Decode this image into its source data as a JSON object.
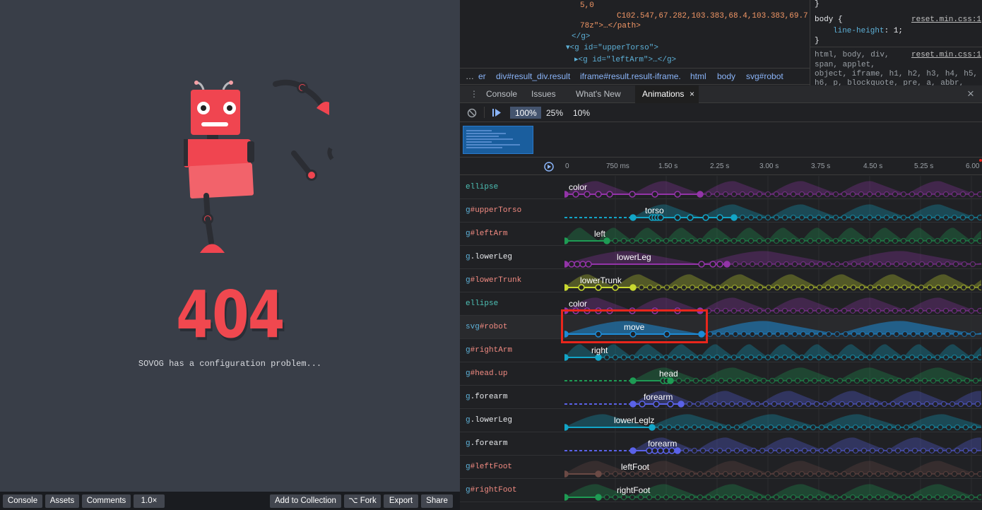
{
  "preview": {
    "big_number": "404",
    "message": "SOVOG has a configuration problem...",
    "bottom_bar": {
      "console": "Console",
      "assets": "Assets",
      "comments": "Comments",
      "zoom": "1.0×",
      "add_collection": "Add to Collection",
      "fork": "⌥ Fork",
      "export": "Export",
      "share": "Share"
    }
  },
  "elements_panel": {
    "lines": [
      "5,0",
      "C102.547,67.282,103.383,68.4,103.383,69.7",
      "78z\">…</path>",
      "</g>",
      "▾<g id=\"upperTorso\">",
      "▸<g id=\"leftArm\">…</g>"
    ],
    "breadcrumbs": [
      "…",
      "er",
      "div#result_div.result",
      "iframe#result.result-iframe.",
      "html",
      "body",
      "svg#robot"
    ]
  },
  "styles_panel": {
    "rule1_selector": "body {",
    "rule1_source": "reset.min.css:1",
    "rule1_prop": "line-height",
    "rule1_value": "1;",
    "rule2_source": "reset.min.css:1",
    "rule2_text_1": "html, body, div,",
    "rule2_text_2": "span, applet,",
    "rule2_text_3": "object, iframe, h1, h2, h3, h4, h5,",
    "rule2_text_4": "h6, p, blockquote, pre, a, abbr,",
    "brace": "}"
  },
  "drawer": {
    "tabs": [
      "Console",
      "Issues",
      "What's New",
      "Animations"
    ],
    "active_tab": "Animations",
    "speeds": [
      "100%",
      "25%",
      "10%"
    ],
    "active_speed": "100%"
  },
  "timeline": {
    "ticks": [
      "0",
      "750 ms",
      "1.50 s",
      "2.25 s",
      "3.00 s",
      "3.75 s",
      "4.50 s",
      "5.25 s",
      "6.00"
    ],
    "rows": [
      {
        "tag": "ellipse",
        "name": "color",
        "color": "#9334a8"
      },
      {
        "tag": "g",
        "id": "#upperTorso",
        "name": "torso",
        "color": "#12a5c7"
      },
      {
        "tag": "g",
        "id": "#leftArm",
        "name": "left",
        "color": "#1e9b54"
      },
      {
        "tag": "g",
        "cls": ".lowerLeg",
        "name": "lowerLeg",
        "color": "#9334a8"
      },
      {
        "tag": "g",
        "id": "#lowerTrunk",
        "name": "lowerTrunk",
        "color": "#c9d930"
      },
      {
        "tag": "ellipse",
        "name": "color",
        "color": "#9334a8"
      },
      {
        "tag": "svg",
        "id": "#robot",
        "name": "move",
        "color": "#1d8bd6"
      },
      {
        "tag": "g",
        "id": "#rightArm",
        "name": "right",
        "color": "#12a5c7"
      },
      {
        "tag": "g",
        "id": "#head.up",
        "name": "head",
        "color": "#1e9b54"
      },
      {
        "tag": "g",
        "cls": ".forearm",
        "name": "forearm",
        "color": "#5a62e8"
      },
      {
        "tag": "g",
        "cls": ".lowerLeg",
        "name": "lowerLeglz",
        "color": "#12a5c7"
      },
      {
        "tag": "g",
        "cls": ".forearm",
        "name": "forearm",
        "color": "#5a62e8"
      },
      {
        "tag": "g",
        "id": "#leftFoot",
        "name": "leftFoot",
        "color": "#6b4a45"
      },
      {
        "tag": "g",
        "id": "#rightFoot",
        "name": "rightFoot",
        "color": "#1e9b54"
      }
    ]
  }
}
